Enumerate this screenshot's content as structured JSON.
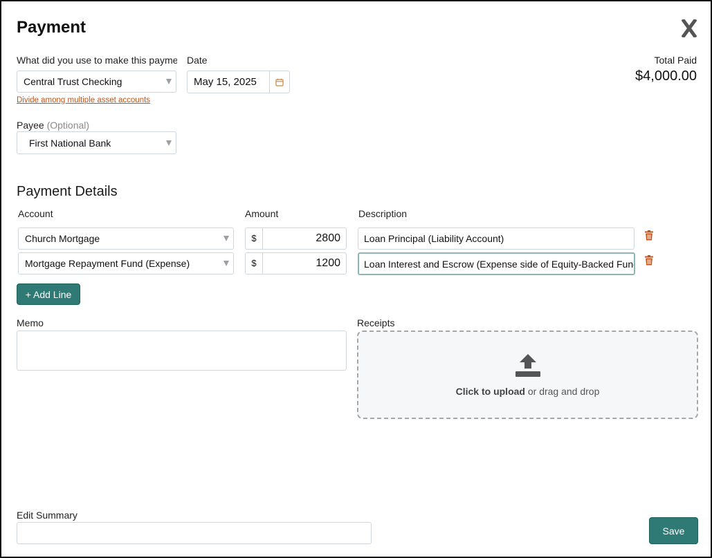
{
  "dialog": {
    "title": "Payment",
    "close_label": "X"
  },
  "payment_source": {
    "label": "What did you use to make this payme...",
    "value": "Central Trust Checking",
    "divide_link": "Divide among multiple asset accounts"
  },
  "date": {
    "label": "Date",
    "value": "May 15, 2025"
  },
  "total": {
    "label": "Total Paid",
    "value": "$4,000.00"
  },
  "payee": {
    "label": "Payee",
    "optional": "(Optional)",
    "value": "First National Bank"
  },
  "details": {
    "title": "Payment Details",
    "col_account": "Account",
    "col_amount": "Amount",
    "col_description": "Description",
    "currency_symbol": "$",
    "lines": [
      {
        "account": "Church Mortgage",
        "amount": "2800",
        "description": "Loan Principal (Liability Account)"
      },
      {
        "account": "Mortgage Repayment Fund (Expense)",
        "amount": "1200",
        "description": "Loan Interest and Escrow (Expense side of Equity-Backed Fund"
      }
    ],
    "add_line_label": "+ Add Line"
  },
  "memo": {
    "label": "Memo",
    "value": ""
  },
  "receipts": {
    "label": "Receipts",
    "upload_bold": "Click to upload",
    "upload_rest": " or drag and drop"
  },
  "edit_summary": {
    "label": "Edit Summary",
    "value": ""
  },
  "save_label": "Save",
  "colors": {
    "accent": "#2f7a74",
    "link": "#c0561b",
    "delete": "#c0561b"
  },
  "icons": {
    "close": "close-icon",
    "calendar": "calendar-icon",
    "trash": "trash-icon",
    "upload": "upload-icon",
    "caret": "chevron-down-icon"
  }
}
